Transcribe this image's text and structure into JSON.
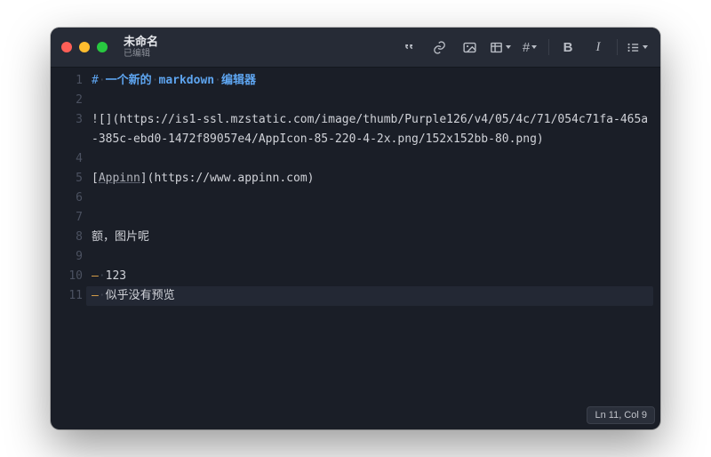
{
  "window": {
    "title": "未命名",
    "subtitle": "已编辑"
  },
  "toolbar": {
    "quote": "quote",
    "link": "link",
    "image": "image",
    "table": "table",
    "heading": "heading",
    "bold": "B",
    "italic": "I",
    "list": "list",
    "hash": "#"
  },
  "editor": {
    "lines": [
      {
        "n": 1,
        "type": "h1",
        "hash": "#",
        "parts": [
          "一个新的",
          "markdown",
          "编辑器"
        ]
      },
      {
        "n": 2,
        "type": "blank"
      },
      {
        "n": 3,
        "type": "image",
        "prefix": "![](",
        "url": "https://is1-ssl.mzstatic.com/image/thumb/Purple126/v4/05/4c/71/054c71fa-465a-385c-ebd0-1472f89057e4/AppIcon-85-220-4-2x.png/152x152bb-80.png",
        "suffix": ")"
      },
      {
        "n": 4,
        "type": "blank"
      },
      {
        "n": 5,
        "type": "link",
        "open": "[",
        "name": "Appinn",
        "mid": "](",
        "url": "https://www.appinn.com",
        "close": ")"
      },
      {
        "n": 6,
        "type": "blank"
      },
      {
        "n": 7,
        "type": "blank"
      },
      {
        "n": 8,
        "type": "text",
        "text": "额，图片呢"
      },
      {
        "n": 9,
        "type": "blank"
      },
      {
        "n": 10,
        "type": "bullet",
        "marker": "–",
        "text": "123"
      },
      {
        "n": 11,
        "type": "bullet",
        "marker": "–",
        "text": "似乎没有预览",
        "current": true
      }
    ]
  },
  "status": {
    "text": "Ln 11, Col 9"
  }
}
